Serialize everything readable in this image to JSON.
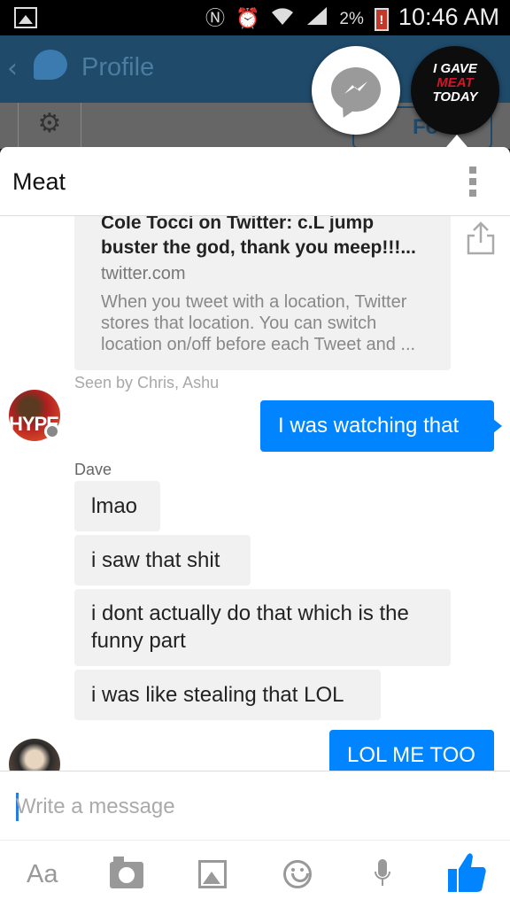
{
  "status_bar": {
    "battery_percent": "2%",
    "time": "10:46 AM",
    "icons": [
      "gallery-icon",
      "nfc-icon",
      "alarm-icon",
      "wifi-icon",
      "signal-icon",
      "battery-low-icon"
    ]
  },
  "background_app": {
    "title": "Profile",
    "follow_label": "Fo"
  },
  "chat_head": {
    "avatar_text": [
      "I GAVE",
      "MEAT",
      "TODAY"
    ]
  },
  "conversation": {
    "title": "Meat",
    "link_card": {
      "title": "Cole Tocci on Twitter: c.L jump buster the god, thank you meep!!!...",
      "domain": "twitter.com",
      "description": "When you tweet with a location, Twitter stores that location. You can switch location on/off before each Tweet and ..."
    },
    "avatar_text": "HYPE",
    "seen_by": "Seen by Chris, Ashu",
    "outgoing_1": "I was watching that",
    "sender_name": "Dave",
    "incoming": [
      "lmao",
      "i saw that shit",
      "i dont actually do that which is the funny part",
      "i was like stealing that LOL"
    ],
    "outgoing_2": "LOL ME TOO"
  },
  "composer": {
    "placeholder": "Write a message",
    "value": ""
  },
  "toolbar": {
    "text_label": "Aa"
  },
  "colors": {
    "messenger_blue": "#0084ff",
    "bubble_gray": "#f1f1f1",
    "status_bar_bg": "#000000"
  }
}
